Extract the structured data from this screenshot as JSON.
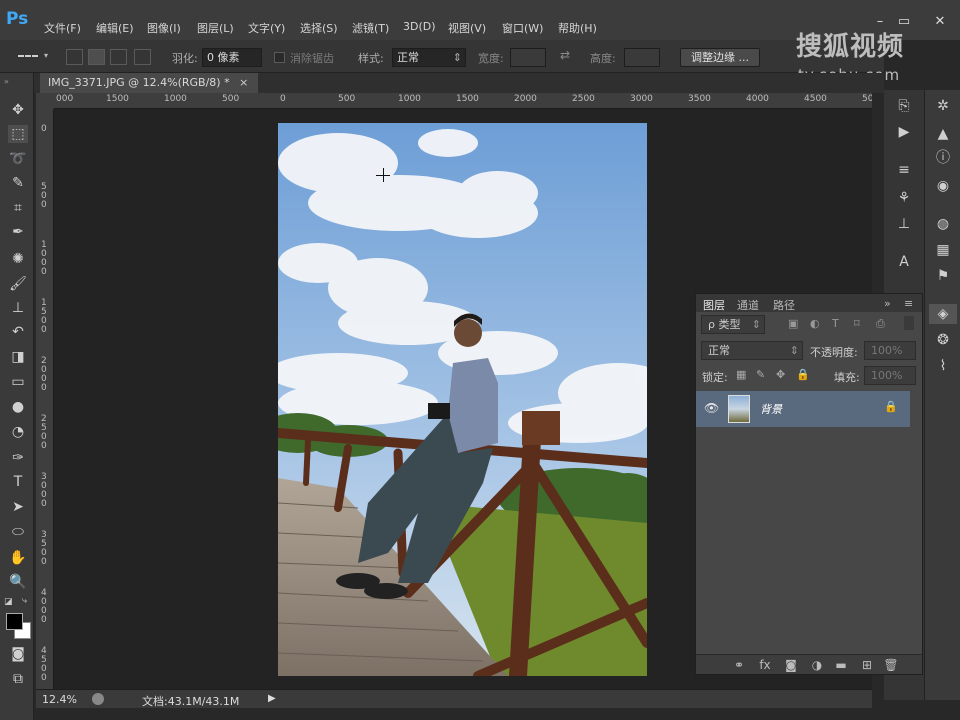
{
  "app": {
    "logo": "Ps"
  },
  "menu": [
    "文件(F)",
    "编辑(E)",
    "图像(I)",
    "图层(L)",
    "文字(Y)",
    "选择(S)",
    "滤镜(T)",
    "3D(D)",
    "视图(V)",
    "窗口(W)",
    "帮助(H)"
  ],
  "window_controls": {
    "minimize": "–",
    "restore": "▭",
    "close": "✕"
  },
  "options": {
    "feather_label": "羽化:",
    "feather_value": "0 像素",
    "antialias_label": "消除锯齿",
    "style_label": "样式:",
    "style_value": "正常",
    "width_label": "宽度:",
    "height_label": "高度:",
    "refine_button": "调整边缘 ..."
  },
  "watermark": {
    "line1": "搜狐视频",
    "line2": "tv.sohu.com"
  },
  "document": {
    "tab_title": "IMG_3371.JPG @ 12.4%(RGB/8) *",
    "tab_close": "×",
    "zoom": "12.4%",
    "doc_info": "文档:43.1M/43.1M"
  },
  "ruler": {
    "horizontal": [
      "000",
      "1500",
      "1000",
      "500",
      "0",
      "500",
      "1000",
      "1500",
      "2000",
      "2500",
      "3000",
      "3500",
      "4000",
      "4500",
      "50"
    ],
    "vertical": [
      "0",
      "500",
      "1000",
      "1500",
      "2000",
      "2500",
      "3000",
      "3500",
      "4000",
      "4500"
    ]
  },
  "layers_panel": {
    "tabs": [
      "图层",
      "通道",
      "路径"
    ],
    "filter_label": "ρ 类型",
    "blend_mode": "正常",
    "opacity_label": "不透明度:",
    "opacity_value": "100%",
    "lock_label": "锁定:",
    "fill_label": "填充:",
    "fill_value": "100%",
    "layers": [
      {
        "name": "背景",
        "visible": true,
        "locked": true
      }
    ]
  },
  "colors": {
    "accent": "#3fa9f5",
    "selected_layer": "#5a6a7e",
    "foreground": "#000000",
    "background": "#ffffff"
  }
}
